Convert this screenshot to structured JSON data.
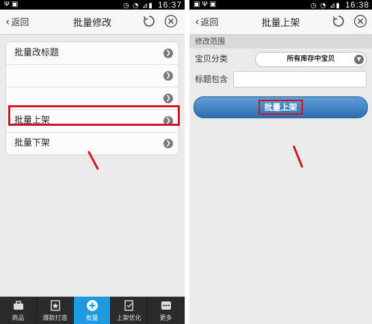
{
  "left": {
    "status": {
      "time": "16:37",
      "icons": [
        "usb-icon",
        "notification-icon",
        "alarm-icon",
        "wifi-icon",
        "signal-icon",
        "battery-icon"
      ]
    },
    "nav": {
      "back_label": "返回",
      "title": "批量修改"
    },
    "menu_items": [
      {
        "label": "批量改标题"
      },
      {
        "label": ""
      },
      {
        "label": ""
      },
      {
        "label": "批量上架",
        "highlighted": true
      },
      {
        "label": "批量下架"
      }
    ],
    "tabs": [
      {
        "label": "商品",
        "icon": "briefcase-icon"
      },
      {
        "label": "爆款打造",
        "icon": "star-icon"
      },
      {
        "label": "批量",
        "icon": "plus-circle-icon",
        "active": true
      },
      {
        "label": "上架优化",
        "icon": "edit-icon"
      },
      {
        "label": "更多",
        "icon": "more-icon"
      }
    ]
  },
  "right": {
    "status": {
      "time": "16:38"
    },
    "nav": {
      "back_label": "返回",
      "title": "批量上架"
    },
    "section_title": "修改范围",
    "category_label": "宝贝分类",
    "category_value": "所有库存中宝贝",
    "title_filter_label": "标题包含",
    "title_filter_value": "",
    "submit_label": "批量上架"
  },
  "colors": {
    "accent": "#1e9ae0",
    "highlight": "#d0101a",
    "button": "#3a7fc0"
  }
}
